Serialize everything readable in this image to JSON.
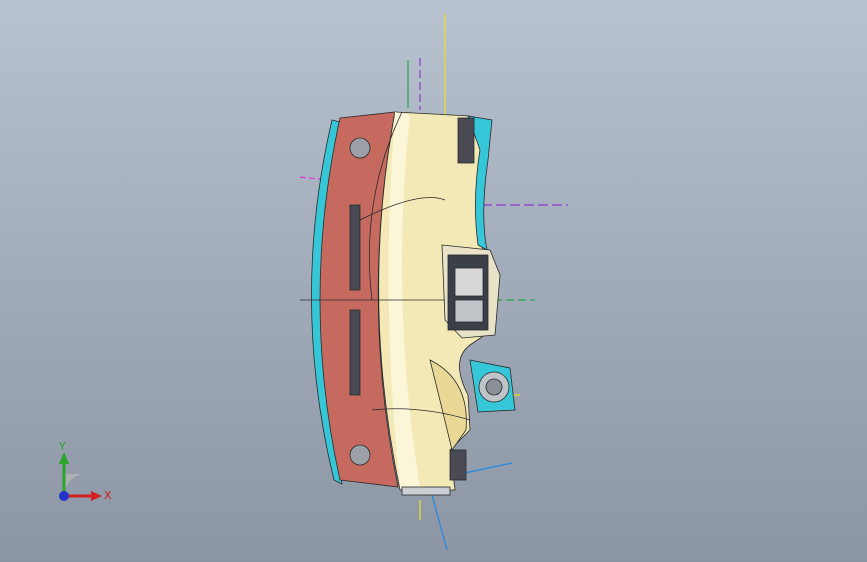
{
  "triad": {
    "y_label": "Y",
    "x_label": "X",
    "y_color": "#2aa52a",
    "x_color": "#d42020",
    "z_color": "#2233cc"
  },
  "model": {
    "fill_colors": {
      "panel": "#c66a60",
      "cream": "#f3e9b6",
      "cyan_edge": "#35c7d8",
      "vent": "#4a4a55"
    },
    "axis_line_colors": [
      "#e9e324",
      "#8a3bd1",
      "#26a84a",
      "#1e88e5",
      "#d93bd1"
    ]
  }
}
